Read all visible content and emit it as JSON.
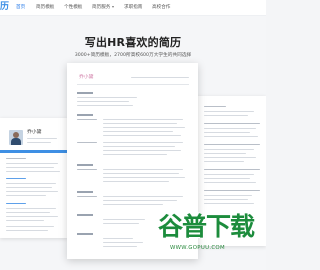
{
  "nav": {
    "logo": "历",
    "items": [
      {
        "label": "首页",
        "active": true
      },
      {
        "label": "简历模板",
        "active": false
      },
      {
        "label": "个性模板",
        "active": false
      },
      {
        "label": "简历服务",
        "active": false,
        "dropdown": true
      },
      {
        "label": "求职指南",
        "active": false
      },
      {
        "label": "高校合作",
        "active": false
      }
    ]
  },
  "hero": {
    "title": "写出HR喜欢的简历",
    "subtitle": "3000+简历模板，2700所高校600万大学生的共同选择"
  },
  "resumes": {
    "main_name": "乔小黛",
    "left_name": "乔小黛"
  },
  "watermark": {
    "text": "谷普下载",
    "url": "WWW.GOPUU.COM"
  },
  "colors": {
    "accent": "#2b7de9",
    "name_pink": "#d07aa6",
    "watermark_green": "#1c8c3c"
  }
}
